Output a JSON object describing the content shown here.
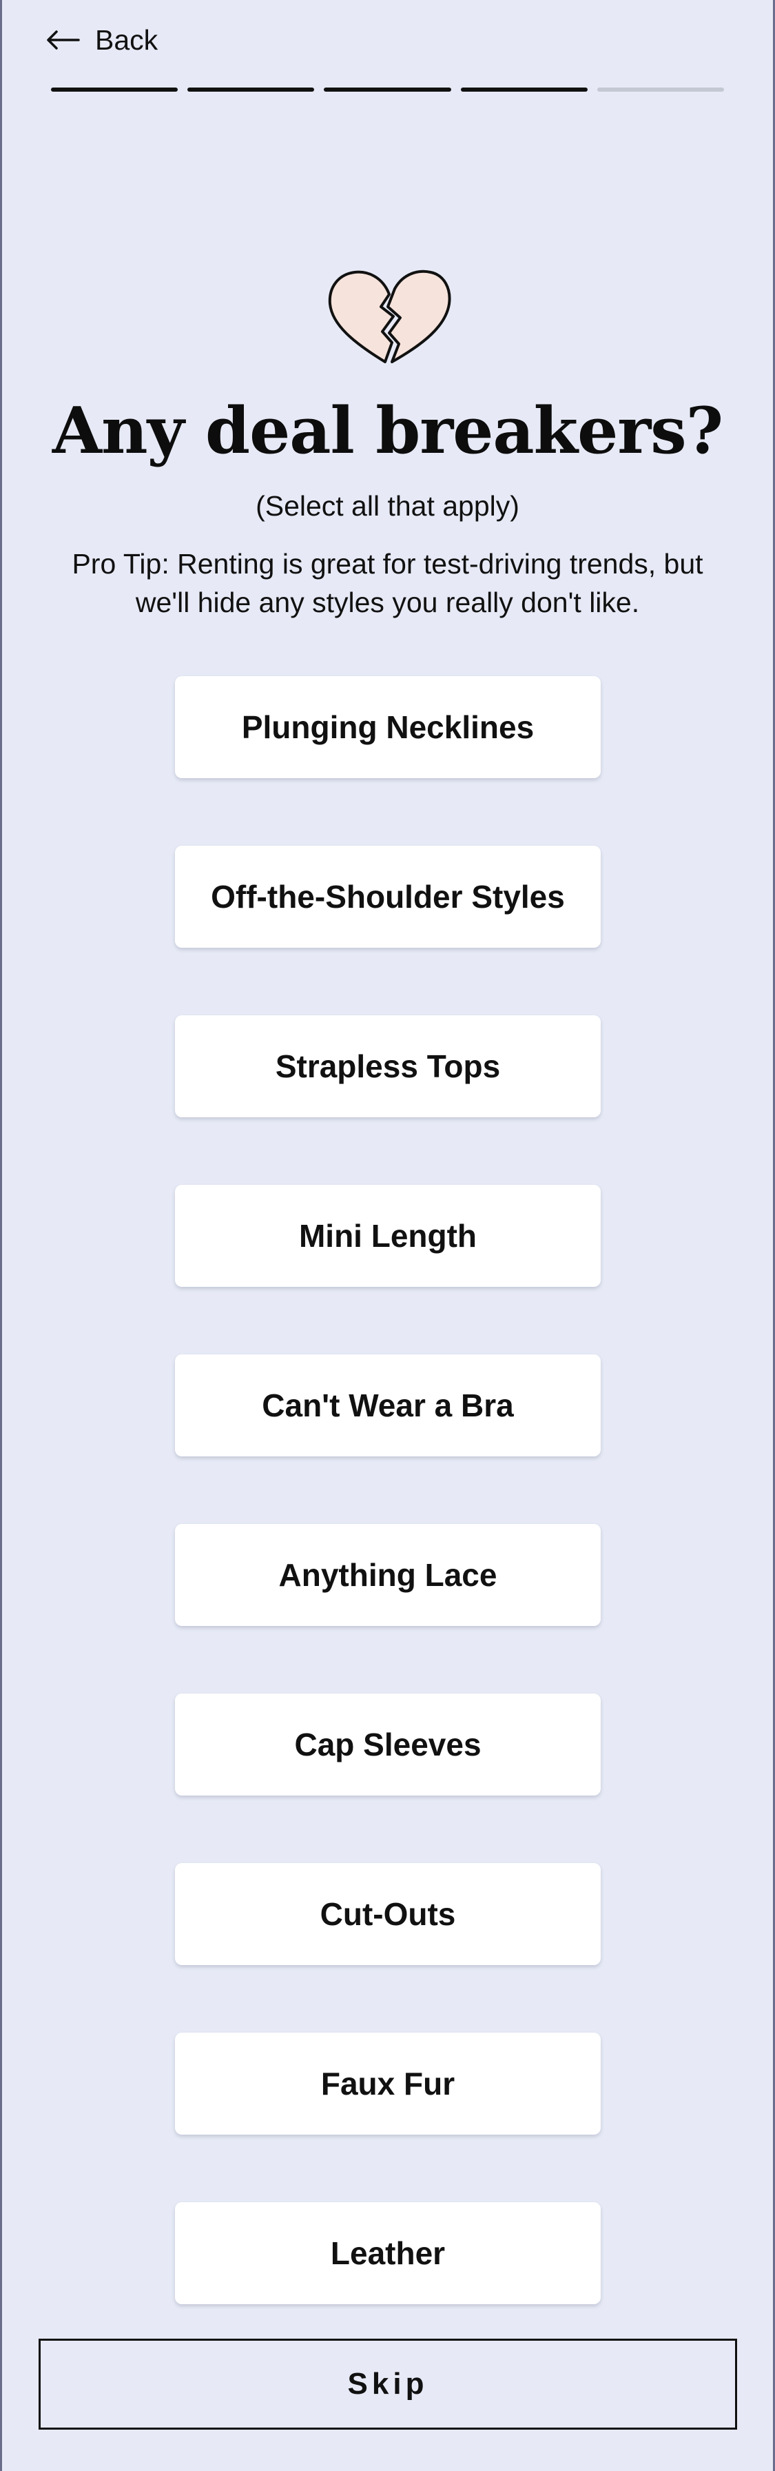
{
  "header": {
    "back_label": "Back",
    "back_icon": "arrow-left-icon",
    "progress": {
      "total_steps": 5,
      "completed_steps": 4
    }
  },
  "hero": {
    "icon": "broken-heart-icon",
    "title": "Any deal breakers?",
    "subtitle": "(Select all that apply)",
    "tip": "Pro Tip: Renting is great for test-driving trends, but we'll hide any styles you really don't like."
  },
  "options": [
    {
      "label": "Plunging Necklines"
    },
    {
      "label": "Off-the-Shoulder Styles"
    },
    {
      "label": "Strapless Tops"
    },
    {
      "label": "Mini Length"
    },
    {
      "label": "Can't Wear a Bra"
    },
    {
      "label": "Anything Lace"
    },
    {
      "label": "Cap Sleeves"
    },
    {
      "label": "Cut-Outs"
    },
    {
      "label": "Faux Fur"
    },
    {
      "label": "Leather"
    }
  ],
  "footer": {
    "skip_label": "Skip"
  },
  "colors": {
    "background": "#e7eaf6",
    "card": "#ffffff",
    "text": "#111111",
    "progress_done": "#111111",
    "progress_todo": "#c4c8d3",
    "heart_fill": "#f6e3dc"
  }
}
